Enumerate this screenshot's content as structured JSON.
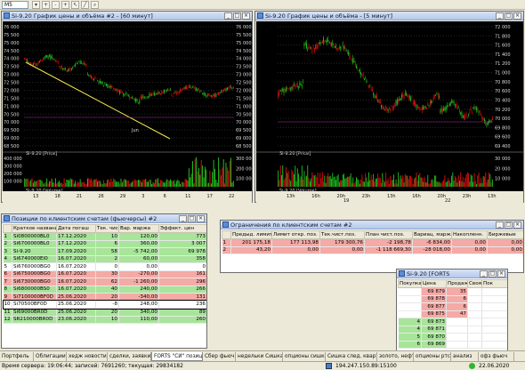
{
  "toolbar": {
    "interval": "M5"
  },
  "chart_left": {
    "title": "Si-9.20 График цены и объёма #2 - [60 минут]",
    "price_legend": "Si-9.20 [Price]",
    "volume_legend": "Si-9.20 [Volume]",
    "y_ticks": [
      "76 000",
      "75 500",
      "75 000",
      "74 500",
      "74 000",
      "73 500",
      "73 000",
      "72 500",
      "72 000",
      "71 500",
      "71 000",
      "70 500",
      "70 000",
      "69 500",
      "69 000",
      "68 500"
    ],
    "vol_ticks": [
      "400 000",
      "300 000",
      "200 000",
      "100 000"
    ],
    "vol_ticks_right": [
      "300 000",
      "200 000",
      "100 000"
    ],
    "x_ticks": [
      "13",
      "18",
      "21",
      "26",
      "29",
      "3",
      "6",
      "11",
      "17",
      "22"
    ],
    "month_label": "Jun",
    "x_ticks_bottom": [
      "13",
      "18",
      "21",
      "26",
      "29",
      "3",
      "6",
      "11",
      "17",
      "22"
    ]
  },
  "chart_right": {
    "title": "Si-9.20 График цены и объёма - [5 минут]",
    "price_legend": "Si-9.20 [Price]",
    "volume_legend": "Si-9.20 [Volume]",
    "y_ticks": [
      "72 000",
      "71 800",
      "71 600",
      "71 400",
      "71 200",
      "71 000",
      "70 800",
      "70 600",
      "70 400",
      "70 200",
      "70 000",
      "69 800",
      "69 600",
      "69 400"
    ],
    "vol_ticks": [
      "30 000",
      "20 000",
      "10 000"
    ],
    "x_ticks": [
      "13h",
      "16h",
      "20h",
      "23h",
      "13h",
      "16h",
      "20h",
      "23h",
      "13h"
    ],
    "day_labels": [
      "19",
      "22"
    ]
  },
  "positions": {
    "title": "Позиции по клиентским счетам (фьючерсы) #2",
    "columns": [
      "",
      "Краткое название",
      "Дата погаш",
      "Тек. чист",
      "Вар. маржа",
      "Эффект. цен"
    ],
    "rows": [
      {
        "n": "1",
        "name": "Si0800000BL0",
        "date": "17.12.2020",
        "qty": "10",
        "vm": "120,00",
        "eff": "773",
        "c": "rg"
      },
      {
        "n": "2",
        "name": "Si6700000BL0",
        "date": "17.12.2020",
        "qty": "6",
        "vm": "360,00",
        "eff": "3 007",
        "c": "rg"
      },
      {
        "n": "3",
        "name": "Si-9.20",
        "date": "17.09.2020",
        "qty": "58",
        "vm": "-5 742,00",
        "eff": "69 978",
        "c": "rg"
      },
      {
        "n": "4",
        "name": "Si6740000EI0",
        "date": "16.07.2020",
        "qty": "2",
        "vm": "60,00",
        "eff": "358",
        "c": "rg"
      },
      {
        "n": "5",
        "name": "Si6760000BG0",
        "date": "16.07.2020",
        "qty": "0",
        "vm": "0,00",
        "eff": "0",
        "c": ""
      },
      {
        "n": "6",
        "name": "Si6750000BG0",
        "date": "16.07.2020",
        "qty": "30",
        "vm": "-270,00",
        "eff": "161",
        "c": "rr"
      },
      {
        "n": "7",
        "name": "Si6730000BG0",
        "date": "16.07.2020",
        "qty": "62",
        "vm": "-1 260,00",
        "eff": "296",
        "c": "rr"
      },
      {
        "n": "8",
        "name": "Si6800000BS0",
        "date": "16.07.2020",
        "qty": "40",
        "vm": "240,00",
        "eff": "266",
        "c": "rg"
      },
      {
        "n": "9",
        "name": "Si7100000BF0D",
        "date": "25.06.2020",
        "qty": "20",
        "vm": "-340,00",
        "eff": "131",
        "c": "rr"
      },
      {
        "n": "10",
        "name": "Si70500BF0D",
        "date": "25.06.2020",
        "qty": "-8",
        "vm": "248,00",
        "eff": "236",
        "c": "rsel"
      },
      {
        "n": "11",
        "name": "Si69000BR0D",
        "date": "25.06.2020",
        "qty": "20",
        "vm": "340,00",
        "eff": "89",
        "c": "rg"
      },
      {
        "n": "12",
        "name": "SR210000BR0D",
        "date": "23.06.2020",
        "qty": "10",
        "vm": "110,00",
        "eff": "260",
        "c": "rg"
      }
    ]
  },
  "limits": {
    "title": "Ограничения по клиентским счетам #2",
    "columns": [
      "",
      "Предыд. лимит",
      "Лимит откр. поз.",
      "Тек.чист.поз.",
      "План чист.поз.",
      "Вариац. маржа",
      "Накопленн.",
      "Биржевые"
    ],
    "rows": [
      {
        "n": "1",
        "prev": "201 175,18",
        "lim": "177 113,98",
        "cur": "179 300,76",
        "plan": "-2 198,78",
        "vm": "-6 834,00",
        "acc": "0,00",
        "ex": "0,00",
        "c": "rr"
      },
      {
        "n": "2",
        "prev": "43,20",
        "lim": "0,00",
        "cur": "0,00",
        "plan": "-1 118 669,30",
        "vm": "-28 018,00",
        "acc": "0,00",
        "ex": "0,00",
        "c": "rr"
      }
    ]
  },
  "orderbook": {
    "title": "Si-9.20 [FORTS",
    "columns": [
      "Покупка",
      "Цена",
      "Продажа",
      "Своя",
      "Пок"
    ],
    "rows": [
      {
        "buy": "",
        "price": "69 879",
        "sell": "35",
        "c": "rr"
      },
      {
        "buy": "",
        "price": "69 878",
        "sell": "6",
        "c": "rr"
      },
      {
        "buy": "",
        "price": "69 877",
        "sell": "6",
        "c": "rr"
      },
      {
        "buy": "",
        "price": "69 875",
        "sell": "47",
        "c": "rr"
      },
      {
        "buy": "4",
        "price": "69 873",
        "sell": "",
        "c": "rg"
      },
      {
        "buy": "4",
        "price": "69 871",
        "sell": "",
        "c": "rg"
      },
      {
        "buy": "5",
        "price": "69 870",
        "sell": "",
        "c": "rg"
      },
      {
        "buy": "6",
        "price": "69 869",
        "sell": "",
        "c": "rg"
      }
    ]
  },
  "tabs": [
    "Портфель",
    "Облигации",
    "хедж новости",
    "сделки, заявки",
    "FORTS \"СИ\" позиции",
    "Сбер фьюч",
    "недельки Сишка",
    "опционы сишка",
    "Сишка след. квартал",
    "золото, нефть",
    "опционы ртс",
    "анализ",
    "офз фьюч"
  ],
  "status": {
    "left": "Время сервера: 19:06:44; записей: 7691260; текущая: 29834182",
    "ip": "194.247.150.89:15100",
    "date": "22.06.2020"
  },
  "colors": {
    "bull": "#1fc41f",
    "bear": "#e01010",
    "trend": "#f2e84a",
    "bg": "#000000"
  }
}
